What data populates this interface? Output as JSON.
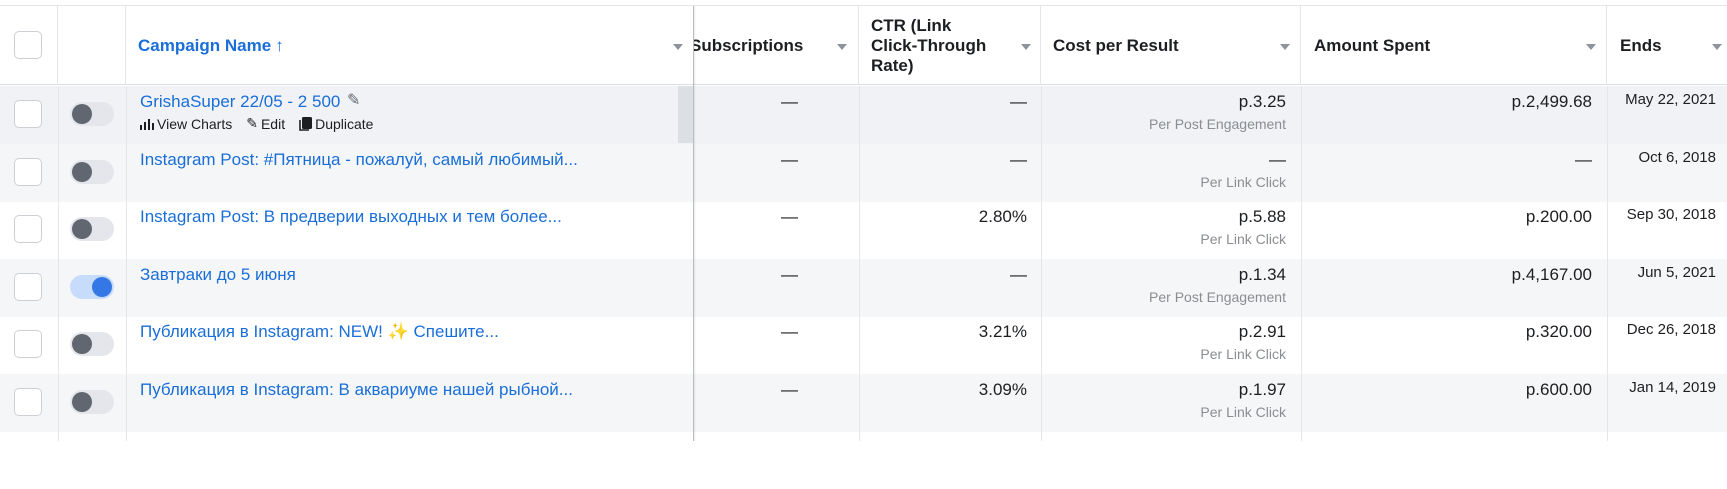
{
  "columns": {
    "campaign_name": "Campaign Name",
    "sort_arrow": "↑",
    "subscriptions": "Subscriptions",
    "ctr_line1": "CTR (Link",
    "ctr_line2": "Click-Through",
    "ctr_line3": "Rate)",
    "cost_per_result": "Cost per Result",
    "amount_spent": "Amount Spent",
    "ends": "Ends"
  },
  "actions": {
    "view_charts": "View Charts",
    "edit": "Edit",
    "duplicate": "Duplicate"
  },
  "rows": [
    {
      "name": "GrishaSuper 22/05 - 2 500",
      "on": false,
      "subscriptions": "—",
      "ctr": "—",
      "cost": "р.3.25",
      "cost_type": "Per Post Engagement",
      "spent": "р.2,499.68",
      "ends": "May 22, 2021"
    },
    {
      "name": "Instagram Post: #Пятница - пожалуй, самый любимый...",
      "on": false,
      "subscriptions": "—",
      "ctr": "—",
      "cost": "—",
      "cost_type": "Per Link Click",
      "spent": "—",
      "ends": "Oct 6, 2018"
    },
    {
      "name": "Instagram Post: В предверии выходных и тем более...",
      "on": false,
      "subscriptions": "—",
      "ctr": "2.80%",
      "cost": "р.5.88",
      "cost_type": "Per Link Click",
      "spent": "р.200.00",
      "ends": "Sep 30, 2018"
    },
    {
      "name": "Завтраки до 5 июня",
      "on": true,
      "subscriptions": "—",
      "ctr": "—",
      "cost": "р.1.34",
      "cost_type": "Per Post Engagement",
      "spent": "р.4,167.00",
      "ends": "Jun 5, 2021"
    },
    {
      "name": "Публикация в Instagram: NEW! ✨ Спешите...",
      "on": false,
      "subscriptions": "—",
      "ctr": "3.21%",
      "cost": "р.2.91",
      "cost_type": "Per Link Click",
      "spent": "р.320.00",
      "ends": "Dec 26, 2018"
    },
    {
      "name": "Публикация в Instagram: В аквариуме нашей рыбной...",
      "on": false,
      "subscriptions": "—",
      "ctr": "3.09%",
      "cost": "р.1.97",
      "cost_type": "Per Link Click",
      "spent": "р.600.00",
      "ends": "Jan 14, 2019"
    }
  ],
  "colors": {
    "link": "#1a6ed8",
    "toggle_on": "#3578e5",
    "border": "#dadde1"
  }
}
